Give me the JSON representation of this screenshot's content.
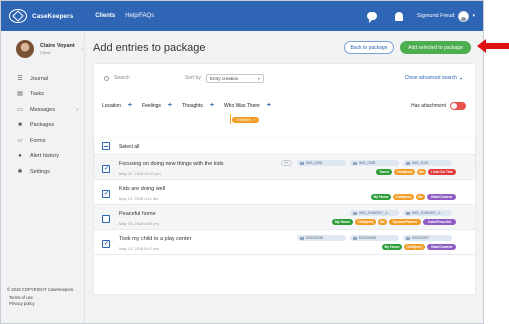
{
  "app": {
    "name": "CaseKeepers"
  },
  "nav": {
    "clients": "Clients",
    "help": "Help/FAQs"
  },
  "user": {
    "name": "Sigmund Freud"
  },
  "profile": {
    "name": "Claire Voyant",
    "role": "Client"
  },
  "sidebar": {
    "items": [
      {
        "label": "Journal",
        "icon": "journal-icon"
      },
      {
        "label": "Tasks",
        "icon": "tasks-icon"
      },
      {
        "label": "Messages",
        "icon": "messages-icon"
      },
      {
        "label": "Packages",
        "icon": "packages-icon"
      },
      {
        "label": "Forms",
        "icon": "forms-icon"
      },
      {
        "label": "Alert history",
        "icon": "alert-icon"
      },
      {
        "label": "Settings",
        "icon": "settings-icon"
      }
    ],
    "terms": "Terms of use",
    "privacy": "Privacy policy",
    "copyright": "© 2018 COPYRIGHT CaseKeepers"
  },
  "page": {
    "title": "Add entries to package",
    "back_label": "Back to package",
    "add_label": "Add selected to package"
  },
  "search": {
    "placeholder": "Search",
    "sort_label": "Sort by",
    "sort_value": "Entry creation",
    "advanced_label": "Close advanced search"
  },
  "filters": {
    "items": [
      "Location",
      "Feelings",
      "Thoughts",
      "Who Was There"
    ],
    "attachment_label": "Has attachment",
    "active_chip": "Child(ren)"
  },
  "list": {
    "select_all": "Select all",
    "entries": [
      {
        "title": "Focusing on doing new things with the kids",
        "date": "May 22, 2018 10:11 pm",
        "checked": true,
        "more": "2+",
        "attachments": [
          "IMG_0096",
          "IMG_0325",
          "IMG_2026"
        ],
        "tags": [
          "Travel",
          "Child(ren)",
          "Me",
          "I Can Do This"
        ]
      },
      {
        "title": "Kids are doing well",
        "date": "May 19, 2018 9:11 am",
        "checked": true,
        "attachments": [],
        "tags": [
          "My Home",
          "Child(ren)",
          "Me",
          "Glad/Content"
        ]
      },
      {
        "title": "Peaceful home",
        "date": "May 15, 2018 6:50 pm",
        "checked": false,
        "attachments": [
          "IMG_20180307_1...",
          "IMG_20180307_1..."
        ],
        "tags": [
          "My Home",
          "Child(ren)",
          "Me",
          "Spouse/Partner",
          "Calm/Peaceful"
        ]
      },
      {
        "title": "Took my child to a play center",
        "date": "May 13, 2018 8:47 pm",
        "checked": true,
        "attachments": [
          "DSC00098",
          "DSC00095",
          "DSC00097"
        ],
        "tags": [
          "My Home",
          "Child(ren)",
          "Glad/Content"
        ]
      }
    ]
  },
  "colors": {
    "brand": "#2e65b5",
    "accent_green": "#4cae4f",
    "tag_green": "#2e9e3a",
    "tag_orange": "#f29b25",
    "tag_red": "#e23b3b",
    "tag_purple": "#8e5cc2",
    "arrow_red": "#e01010"
  }
}
